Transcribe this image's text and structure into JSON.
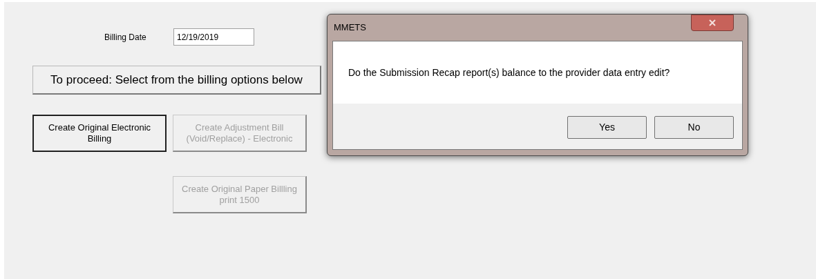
{
  "form": {
    "billing_date": {
      "label": "Billing Date",
      "value": "12/19/2019"
    },
    "prompt_button": "To proceed: Select from the billing options below",
    "options": [
      {
        "label": "Create Original Electronic Billing",
        "disabled": false,
        "focused": true
      },
      {
        "label": "Create Adjustment Bill (Void/Replace) - Electronic",
        "disabled": true,
        "focused": false
      },
      {
        "label": "Create Original Paper Billling print 1500",
        "disabled": true,
        "focused": false
      }
    ]
  },
  "dialog": {
    "title": "MMETS",
    "message": "Do the Submission Recap report(s) balance to the provider data entry edit?",
    "buttons": [
      "Yes",
      "No"
    ]
  }
}
